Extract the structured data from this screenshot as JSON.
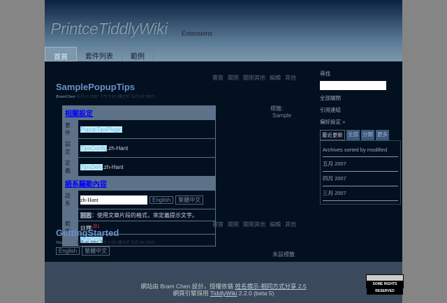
{
  "header": {
    "title": "PrintceTiddlyWiki",
    "subtitle": "Extensions"
  },
  "tabs": [
    "首頁",
    "套件列表",
    "範例"
  ],
  "toolbar": [
    "書簽",
    "關閉",
    "關閉其他",
    "編輯",
    "其他"
  ],
  "tiddlers": [
    {
      "title": "SamplePopupTips",
      "author": "BramChen",
      "date": "五月 11 2007 下午 5:10 (建立於 五月 06 2007)",
      "tags_label": "標籤:",
      "tags": "Sample"
    },
    {
      "title": "GettingStarted",
      "author": "YourName",
      "date": "五月 06 2007 下午 5:58 (建立於 五月 06 2007)",
      "tags_label": "未設標籤",
      "buttons": [
        "English",
        "繁體中文"
      ]
    }
  ],
  "table": {
    "h1": "相關設定",
    "rows": [
      {
        "label": "套件",
        "link": "PopupTipsPlugin",
        "extra": ""
      },
      {
        "label": "設定",
        "link": "TipsConfig",
        "extra": ".zh-Hant"
      },
      {
        "label": "定義",
        "link": "TipsDefs",
        "extra": ".zh-Hant"
      }
    ],
    "h2": "語系驅動內容",
    "lang_label": "語系",
    "lang_value": "zh-Hant",
    "lang_buttons": [
      "English",
      "繁體中文"
    ],
    "example_label": "範例",
    "alias": "別名",
    "alias_text": "：使用文章片段的格式，來定義提示文字。",
    "note": "註釋:",
    "note_mark": "註1",
    "usage": "使用說明"
  },
  "sidebar": {
    "search_label": "尋找",
    "search_value": "",
    "links": [
      "全部關閉",
      "引用連結",
      "偏好設定 »"
    ],
    "tabs": [
      "最近更新",
      "全部",
      "分類",
      "更多"
    ],
    "archive_title": "Archives sorted by modified",
    "archives": [
      "五月 2007",
      "四月 2007",
      "三月 2007"
    ]
  },
  "footer": {
    "line1_pre": "網站由 Bram Chen 設計，授權依循 ",
    "license": "姓名標示-相同方式分享 2.5",
    "line2_pre": "網頁引擎採用 ",
    "engine": "TiddlyWiki",
    "line2_post": " 2.2.0 (beta 5)",
    "cc_badge": "SOME RIGHTS RESERVED"
  }
}
